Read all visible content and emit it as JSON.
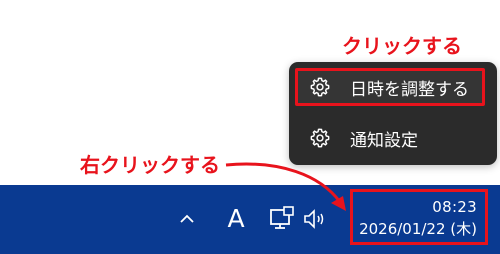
{
  "annotations": {
    "top_label": "クリックする",
    "left_label": "右クリックする",
    "highlight_color": "#e8131c"
  },
  "context_menu": {
    "items": [
      {
        "label": "日時を調整する",
        "icon": "gear-icon",
        "highlighted": true
      },
      {
        "label": "通知設定",
        "icon": "gear-icon",
        "highlighted": false
      }
    ],
    "background_color": "#2b2b2b"
  },
  "taskbar": {
    "background_color": "#0a3a91",
    "tray": {
      "overflow_icon": "chevron-up-icon",
      "ime_indicator": "A",
      "network_icon": "network-icon",
      "volume_icon": "volume-icon"
    },
    "clock": {
      "time": "08:23",
      "date": "2026/01/22 (木)"
    }
  }
}
